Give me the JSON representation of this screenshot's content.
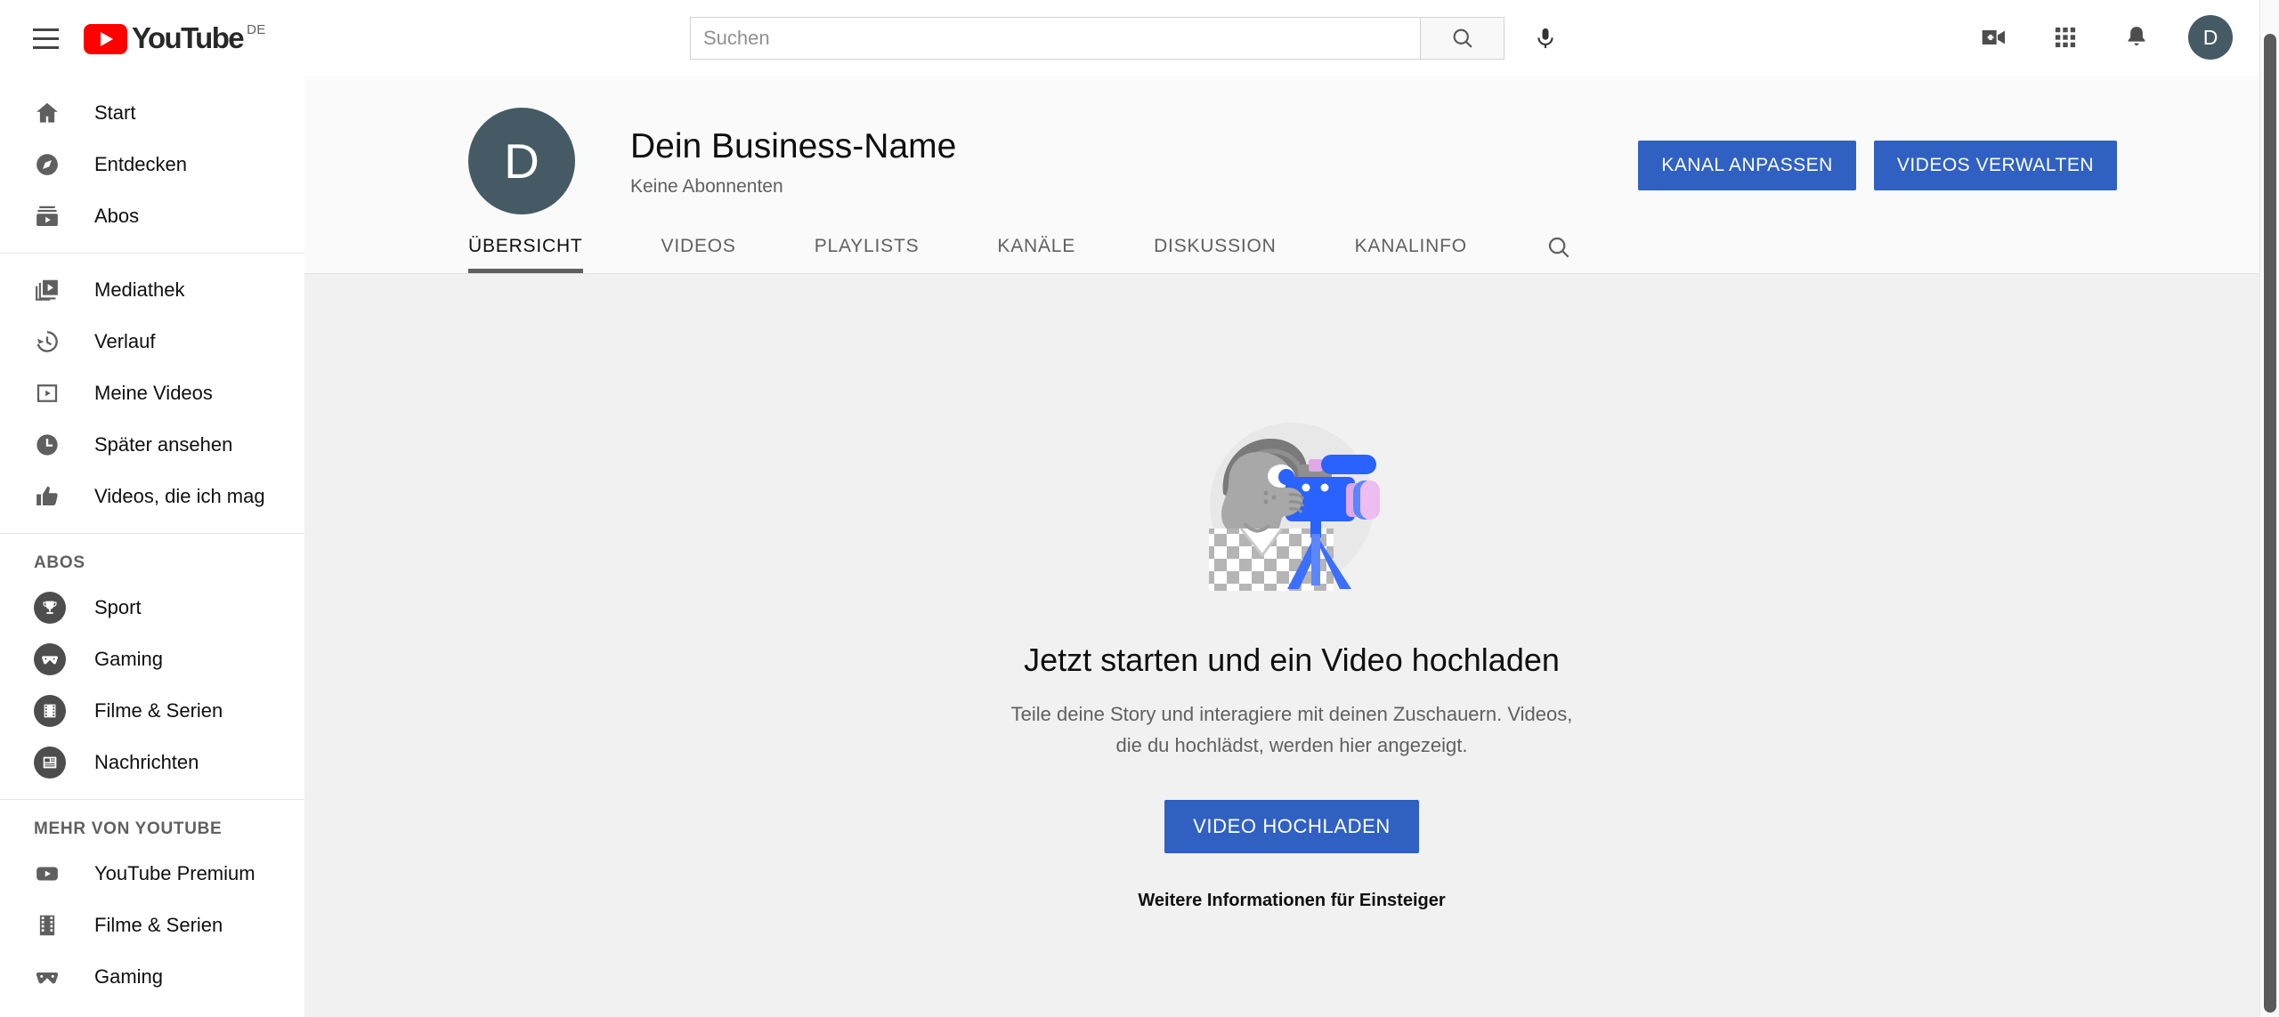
{
  "topbar": {
    "menu_icon": "hamburger-icon",
    "logo_text": "YouTube",
    "logo_country": "DE",
    "search_placeholder": "Suchen",
    "search_value": "",
    "search_icon": "search-icon",
    "mic_icon": "microphone-icon",
    "create_icon": "video-add-icon",
    "apps_icon": "apps-grid-icon",
    "notifications_icon": "bell-icon",
    "avatar_letter": "D"
  },
  "sidebar": {
    "main": [
      {
        "label": "Start",
        "icon": "home-icon"
      },
      {
        "label": "Entdecken",
        "icon": "compass-icon"
      },
      {
        "label": "Abos",
        "icon": "subscriptions-icon"
      }
    ],
    "library": [
      {
        "label": "Mediathek",
        "icon": "library-icon"
      },
      {
        "label": "Verlauf",
        "icon": "history-icon"
      },
      {
        "label": "Meine Videos",
        "icon": "my-videos-icon"
      },
      {
        "label": "Später ansehen",
        "icon": "clock-icon"
      },
      {
        "label": "Videos, die ich mag",
        "icon": "thumbs-up-icon"
      }
    ],
    "subs_header": "ABOS",
    "subscriptions": [
      {
        "label": "Sport",
        "icon": "trophy-icon"
      },
      {
        "label": "Gaming",
        "icon": "gamepad-icon"
      },
      {
        "label": "Filme & Serien",
        "icon": "film-icon"
      },
      {
        "label": "Nachrichten",
        "icon": "newspaper-icon"
      }
    ],
    "more_header": "MEHR VON YOUTUBE",
    "more": [
      {
        "label": "YouTube Premium",
        "icon": "youtube-premium-icon"
      },
      {
        "label": "Filme & Serien",
        "icon": "film-strip-icon"
      },
      {
        "label": "Gaming",
        "icon": "gamepad-icon"
      }
    ]
  },
  "channel": {
    "avatar_letter": "D",
    "name": "Dein Business-Name",
    "subscribers": "Keine Abonnenten",
    "customize_button": "KANAL ANPASSEN",
    "manage_videos_button": "VIDEOS VERWALTEN",
    "tabs": [
      {
        "label": "ÜBERSICHT",
        "active": true
      },
      {
        "label": "VIDEOS",
        "active": false
      },
      {
        "label": "PLAYLISTS",
        "active": false
      },
      {
        "label": "KANÄLE",
        "active": false
      },
      {
        "label": "DISKUSSION",
        "active": false
      },
      {
        "label": "KANALINFO",
        "active": false
      }
    ],
    "tab_search_icon": "search-icon"
  },
  "empty_state": {
    "illustration": "person-with-video-camera-illustration",
    "title": "Jetzt starten und ein Video hochladen",
    "description": "Teile deine Story und interagiere mit deinen Zuschauern. Videos, die du hochlädst, werden hier angezeigt.",
    "upload_button": "VIDEO HOCHLADEN",
    "help_link": "Weitere Informationen für Einsteiger"
  },
  "colors": {
    "brand_red": "#ff0000",
    "accent_blue": "#3061c2",
    "avatar_slate": "#455a64",
    "content_bg": "#f1f1f1",
    "header_bg": "#fafafa"
  }
}
